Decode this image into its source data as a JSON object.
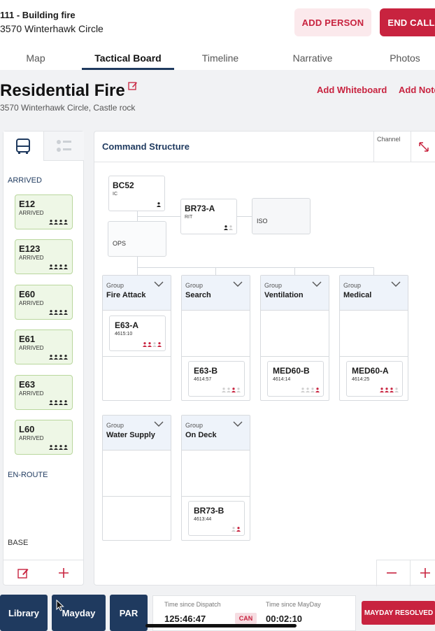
{
  "header": {
    "title": "111 - Building fire",
    "address": "3570 Winterhawk Circle",
    "add_person": "ADD PERSON",
    "end_call": "END CALL"
  },
  "tabs": [
    "Map",
    "Tactical Board",
    "Timeline",
    "Narrative",
    "Photos"
  ],
  "active_tab": "Tactical Board",
  "board": {
    "title": "Residential Fire",
    "subtitle": "3570 Winterhawk Circle, Castle rock",
    "add_whiteboard": "Add Whiteboard",
    "add_note": "Add Note"
  },
  "left_panel": {
    "arrived_label": "ARRIVED",
    "enroute_label": "EN-ROUTE",
    "base_label": "BASE",
    "units": [
      {
        "name": "E12",
        "status": "ARRIVED"
      },
      {
        "name": "E123",
        "status": "ARRIVED"
      },
      {
        "name": "E60",
        "status": "ARRIVED"
      },
      {
        "name": "E61",
        "status": "ARRIVED"
      },
      {
        "name": "E63",
        "status": "ARRIVED"
      },
      {
        "name": "L60",
        "status": "ARRIVED"
      }
    ]
  },
  "command": {
    "title": "Command Structure",
    "channel_label": "Channel",
    "bc": {
      "name": "BC52",
      "role": "IC"
    },
    "rit": {
      "name": "BR73-A",
      "role": "RIT"
    },
    "iso": "ISO",
    "ops": "OPS",
    "group_label": "Group",
    "groups": [
      {
        "name": "Fire Attack",
        "unit": "E63-A",
        "time": "4615:10"
      },
      {
        "name": "Search",
        "unit": "E63-B",
        "time": "4614:57"
      },
      {
        "name": "Ventilation",
        "unit": "MED60-B",
        "time": "4614:14"
      },
      {
        "name": "Medical",
        "unit": "MED60-A",
        "time": "4614:25"
      },
      {
        "name": "Water Supply"
      },
      {
        "name": "On Deck",
        "unit": "BR73-B",
        "time": "4613:44"
      }
    ]
  },
  "footer": {
    "library": "Library",
    "mayday": "Mayday",
    "par": "PAR",
    "time_since_dispatch_label": "Time since Dispatch",
    "time_since_dispatch": "125:46:47",
    "can": "CAN",
    "time_since_mayday_label": "Time since MayDay",
    "time_since_mayday": "00:02:10",
    "mayday_resolved": "MAYDAY RESOLVED"
  },
  "colors": {
    "accent_red": "#c8233f",
    "navy": "#1f3a5f",
    "arrived_green": "#eef7e6"
  }
}
